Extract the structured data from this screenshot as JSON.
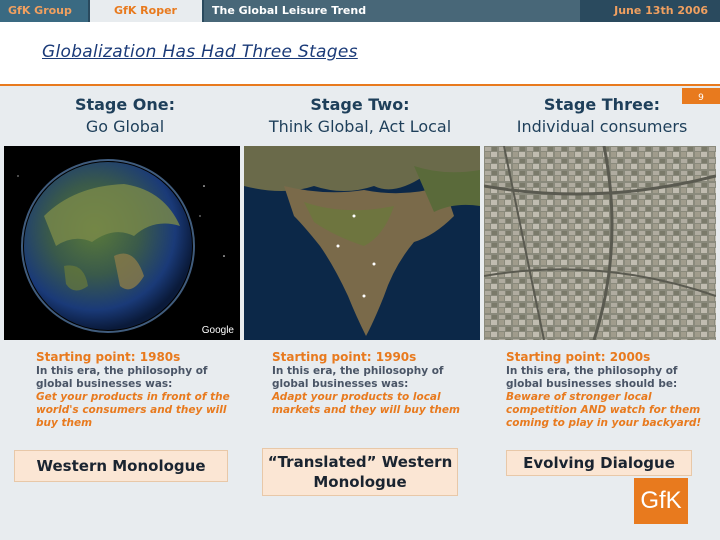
{
  "header": {
    "tab_group": "GfK Group",
    "tab_roper": "GfK Roper",
    "tab_trend": "The Global Leisure Trend",
    "date": "June 13th 2006"
  },
  "title": "Globalization Has Had Three Stages",
  "page_number": "9",
  "stages": [
    {
      "title": "Stage One:",
      "subtitle": "Go Global",
      "image": "globe-from-space",
      "starting_point": "Starting point: 1980s",
      "intro": "In this era, the philosophy of global businesses was:",
      "philosophy": "Get your products in front of the world's consumers and they will buy them",
      "dialogue": "Western Monologue"
    },
    {
      "title": "Stage Two:",
      "subtitle": "Think Global, Act Local",
      "image": "satellite-map-of-india",
      "starting_point": "Starting point: 1990s",
      "intro": "In this era, the philosophy of global businesses was:",
      "philosophy": "Adapt your products to local markets and they will buy them",
      "dialogue": "“Translated” Western Monologue"
    },
    {
      "title": "Stage Three:",
      "subtitle": "Individual consumers",
      "image": "aerial-view-of-dense-city",
      "starting_point": "Starting point: 2000s",
      "intro": "In this era, the philosophy of global businesses should be:",
      "philosophy": "Beware of stronger local competition AND watch for them coming to play in your backyard!",
      "dialogue": "Evolving Dialogue"
    }
  ],
  "photo_watermark": "Google",
  "logo": "GfK",
  "colors": {
    "accent": "#e87a1e",
    "navy": "#1e3f5a",
    "title_blue": "#1a3a78",
    "bar": "#2a4a5e"
  }
}
